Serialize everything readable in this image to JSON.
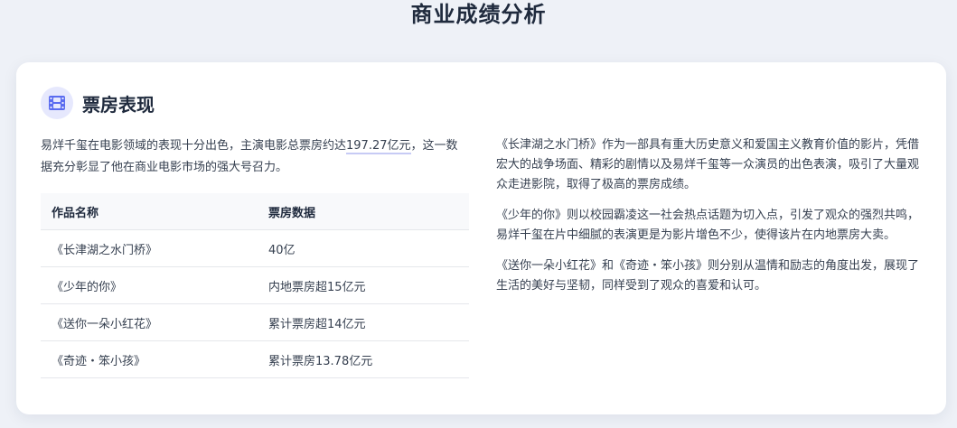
{
  "page": {
    "title": "商业成绩分析"
  },
  "section": {
    "title": "票房表现",
    "icon": "film-icon",
    "accent_color": "#5b6cf0",
    "icon_bg_color": "#e6e8fd"
  },
  "intro": {
    "before": "易烊千玺在电影领域的表现十分出色，主演电影总票房约达",
    "highlight": "197.27亿元",
    "after": "，这一数据充分彰显了他在商业电影市场的强大号召力。"
  },
  "table": {
    "headers": [
      "作品名称",
      "票房数据"
    ],
    "rows": [
      [
        "《长津湖之水门桥》",
        "40亿"
      ],
      [
        "《少年的你》",
        "内地票房超15亿元"
      ],
      [
        "《送你一朵小红花》",
        "累计票房超14亿元"
      ],
      [
        "《奇迹・笨小孩》",
        "累计票房13.78亿元"
      ]
    ]
  },
  "paragraphs": [
    "《长津湖之水门桥》作为一部具有重大历史意义和爱国主义教育价值的影片，凭借宏大的战争场面、精彩的剧情以及易烊千玺等一众演员的出色表演，吸引了大量观众走进影院，取得了极高的票房成绩。",
    "《少年的你》则以校园霸凌这一社会热点话题为切入点，引发了观众的强烈共鸣，易烊千玺在片中细腻的表演更是为影片增色不少，使得该片在内地票房大卖。",
    "《送你一朵小红花》和《奇迹・笨小孩》则分别从温情和励志的角度出发，展现了生活的美好与坚韧，同样受到了观众的喜爱和认可。"
  ]
}
